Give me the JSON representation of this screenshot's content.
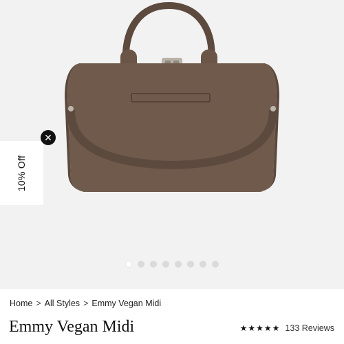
{
  "promo": {
    "label": "10% Off",
    "close_glyph": "✕"
  },
  "gallery": {
    "image_count": 8,
    "active_index": 0
  },
  "breadcrumb": {
    "items": [
      "Home",
      "All Styles",
      "Emmy Vegan Midi"
    ],
    "separator": ">"
  },
  "product": {
    "title": "Emmy Vegan Midi",
    "rating": 5,
    "reviews_label": "133 Reviews"
  },
  "colors": {
    "bag": "#6f5a4c",
    "gallery_bg": "#f2f2f2",
    "star": "#111111"
  },
  "icons": [
    "close-icon",
    "star-icon",
    "bag-image"
  ]
}
